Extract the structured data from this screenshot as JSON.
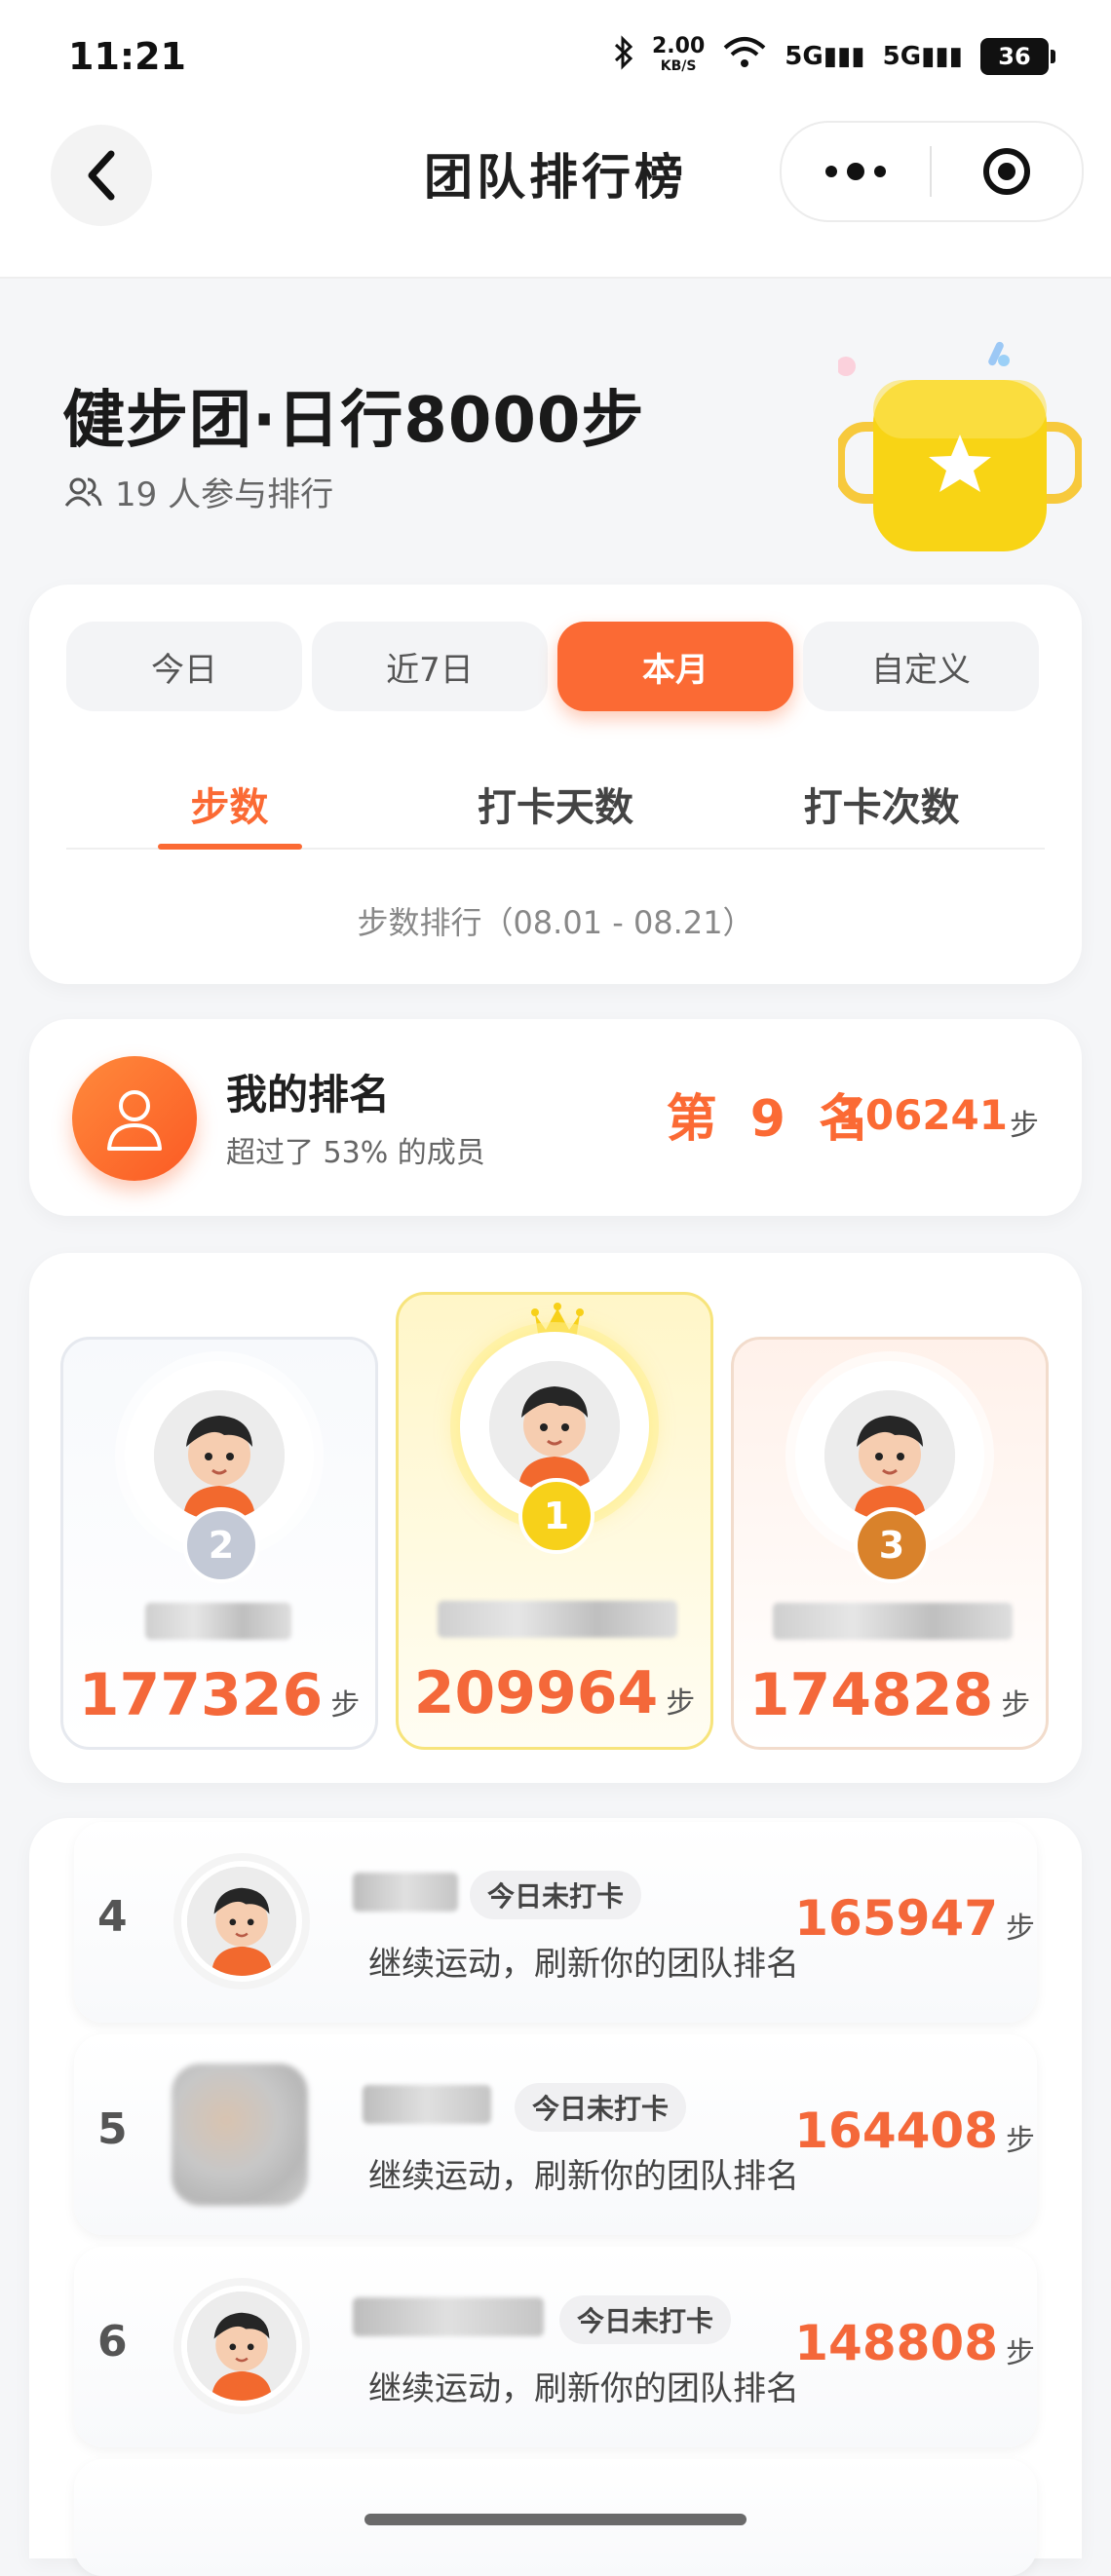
{
  "status_bar": {
    "time": "11:21",
    "net_speed": "2.00",
    "net_unit": "KB/S",
    "sig1": "5G",
    "sig2": "5G",
    "battery": "36"
  },
  "nav": {
    "title": "团队排行榜"
  },
  "header": {
    "team_title": "健步团·日行8000步",
    "participants": "19 人参与排行"
  },
  "range_tabs": [
    {
      "label": "今日",
      "active": false
    },
    {
      "label": "近7日",
      "active": false
    },
    {
      "label": "本月",
      "active": true
    },
    {
      "label": "自定义",
      "active": false
    }
  ],
  "metric_tabs": [
    {
      "label": "步数",
      "active": true
    },
    {
      "label": "打卡天数",
      "active": false
    },
    {
      "label": "打卡次数",
      "active": false
    }
  ],
  "range_caption": "步数排行（08.01 - 08.21）",
  "my_rank": {
    "title": "我的排名",
    "subtitle": "超过了 53% 的成员",
    "rank": "第 9 名",
    "steps": "106241",
    "unit": "步"
  },
  "podium": {
    "first": {
      "rank": "1",
      "steps": "209964",
      "unit": "步"
    },
    "second": {
      "rank": "2",
      "steps": "177326",
      "unit": "步"
    },
    "third": {
      "rank": "3",
      "steps": "174828",
      "unit": "步"
    }
  },
  "list": [
    {
      "rank": "4",
      "badge": "今日未打卡",
      "subtitle": "继续运动，刷新你的团队排名",
      "steps": "165947",
      "unit": "步"
    },
    {
      "rank": "5",
      "badge": "今日未打卡",
      "subtitle": "继续运动，刷新你的团队排名",
      "steps": "164408",
      "unit": "步"
    },
    {
      "rank": "6",
      "badge": "今日未打卡",
      "subtitle": "继续运动，刷新你的团队排名",
      "steps": "148808",
      "unit": "步"
    }
  ],
  "colors": {
    "accent": "#fb6a34",
    "gold": "#f7d11a",
    "silver": "#c3c9d6",
    "bronze": "#d9822b"
  }
}
